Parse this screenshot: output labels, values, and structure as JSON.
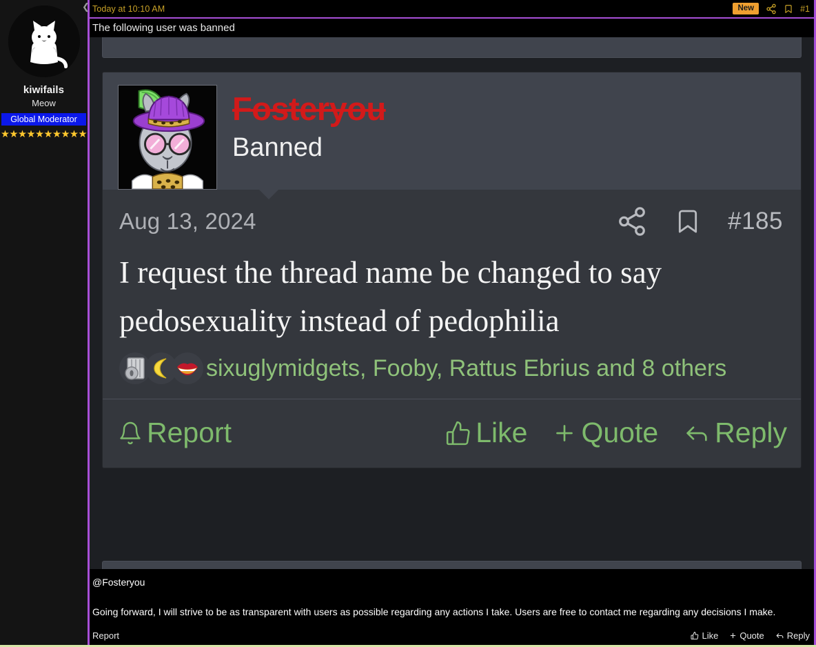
{
  "sidebar": {
    "avatar_icon": "white-cat-avatar",
    "username": "kiwifails",
    "user_title": "Meow",
    "badge_label": "Global Moderator",
    "badge_color": "#0b18ea",
    "stars": "★★★★★★★★★★",
    "star_count": 10,
    "star_color": "#ffc82e"
  },
  "topbar": {
    "chevron_icon": "chevron-left-icon",
    "date": "Today at 10:10 AM",
    "new_badge": "New",
    "new_badge_color": "#f0a030",
    "share_icon": "share-icon",
    "bookmark_icon": "bookmark-icon",
    "post_number": "#1",
    "accent_color": "#c9a227"
  },
  "banner": {
    "text": "The following user was banned"
  },
  "post": {
    "avatar_icon": "purple-hat-rabbit-avatar",
    "username": "Fosteryou",
    "username_color": "#d21a1a",
    "username_strikethrough": true,
    "user_state": "Banned",
    "date": "Aug 13, 2024",
    "share_icon": "share-icon",
    "bookmark_icon": "bookmark-icon",
    "post_number": "#185",
    "body": "I request the thread name be changed to say pedosexuality instead of pedophilia",
    "reactions": {
      "emojis": [
        "film-reel-emoji",
        "crescent-moon-emoji",
        "red-lips-emoji"
      ],
      "names": "sixuglymidgets, Fooby, Rattus Ebrius and 8 others",
      "names_color": "#8fc27a",
      "other_count": 8
    },
    "actions": {
      "report": "Report",
      "report_icon": "bell-icon",
      "like": "Like",
      "like_icon": "thumbs-up-icon",
      "quote": "Quote",
      "quote_icon": "plus-icon",
      "reply": "Reply",
      "reply_icon": "reply-arrow-icon",
      "color": "#7eba6c"
    }
  },
  "bottom_post": {
    "mention": "@Fosteryou",
    "text": "Going forward, I will strive to be as transparent with users as possible regarding any actions I take. Users are free to contact me regarding any decisions I make.",
    "actions": {
      "report": "Report",
      "like": "Like",
      "like_icon": "thumbs-up-icon",
      "quote": "Quote",
      "quote_icon": "plus-icon",
      "reply": "Reply",
      "reply_icon": "reply-arrow-icon"
    }
  },
  "theme": {
    "page_background": "#000000",
    "sidebar_background": "#141414",
    "purple_border": "#a84fd8",
    "bottom_border": "#d6e6a8",
    "post_header_background": "#40444d",
    "post_body_background": "#34373d"
  }
}
